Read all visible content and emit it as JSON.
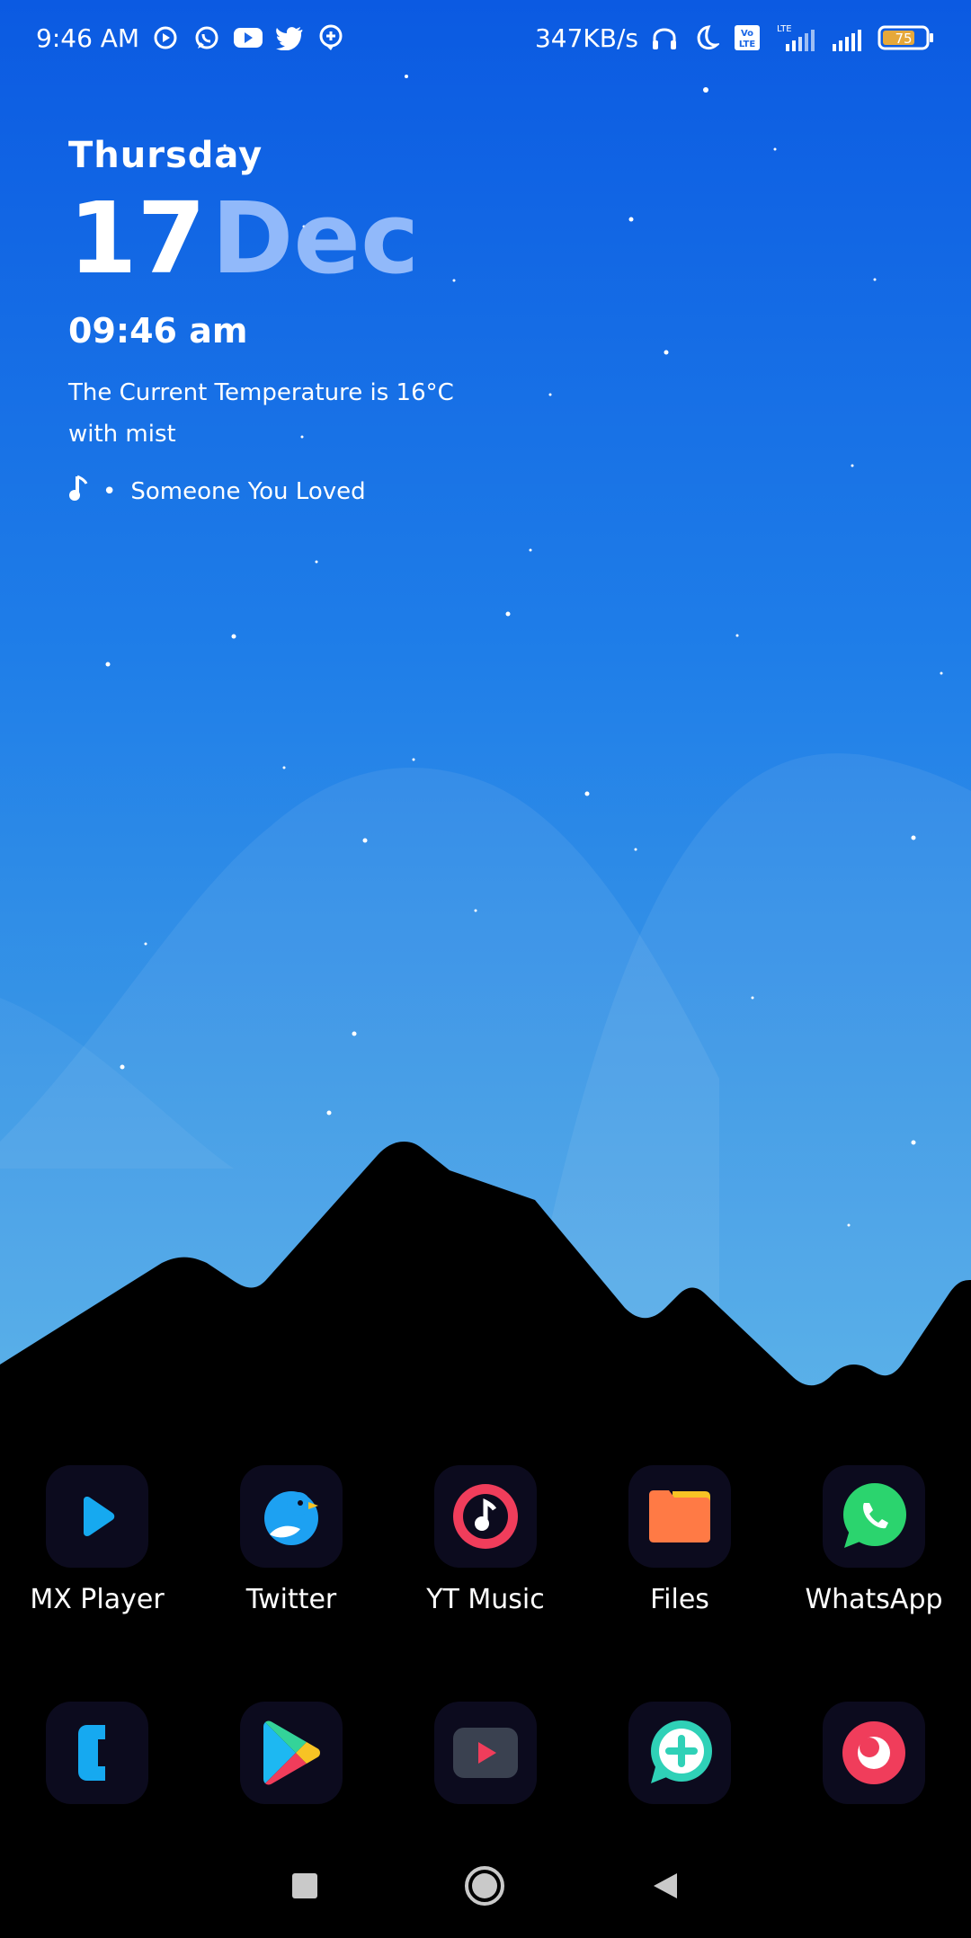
{
  "status_bar": {
    "time": "9:46 AM",
    "network_speed": "347KB/s",
    "battery": "75",
    "left_icons": [
      "mx-player-notification-icon",
      "whatsapp-notification-icon",
      "youtube-notification-icon",
      "twitter-notification-icon",
      "ai-notification-icon"
    ],
    "right_icons": [
      "headphones-icon",
      "do-not-disturb-moon-icon",
      "volte-icon",
      "lte-signal-icon",
      "signal-icon",
      "battery-icon"
    ]
  },
  "widget": {
    "day": "Thursday",
    "date_number": "17",
    "date_month": "Dec",
    "time": "09:46 am",
    "weather": "The Current Temperature is 16°C with mist",
    "music_separator": "•",
    "music_title": "Someone You Loved"
  },
  "dock_row1": [
    {
      "label": "MX Player",
      "icon": "mx-player-icon"
    },
    {
      "label": "Twitter",
      "icon": "twitter-icon"
    },
    {
      "label": "YT Music",
      "icon": "yt-music-icon"
    },
    {
      "label": "Files",
      "icon": "files-icon"
    },
    {
      "label": "WhatsApp",
      "icon": "whatsapp-icon"
    }
  ],
  "dock_row2": [
    {
      "label": "",
      "icon": "phone-icon"
    },
    {
      "label": "",
      "icon": "play-store-icon"
    },
    {
      "label": "",
      "icon": "youtube-icon"
    },
    {
      "label": "",
      "icon": "add-message-icon"
    },
    {
      "label": "",
      "icon": "camera-icon"
    }
  ],
  "nav": {
    "recents_icon": "recents-square-icon",
    "home_icon": "home-circle-icon",
    "back_icon": "back-triangle-icon"
  },
  "colors": {
    "sky_top": "#0c5ce4",
    "sky_bottom": "#4aa6e6",
    "tile_bg": "#0c0b1e",
    "accent_blue": "#16a9f0",
    "whatsapp_green": "#2bd46e",
    "ytmusic_red": "#f03d5b",
    "files_orange": "#ff7a45"
  }
}
